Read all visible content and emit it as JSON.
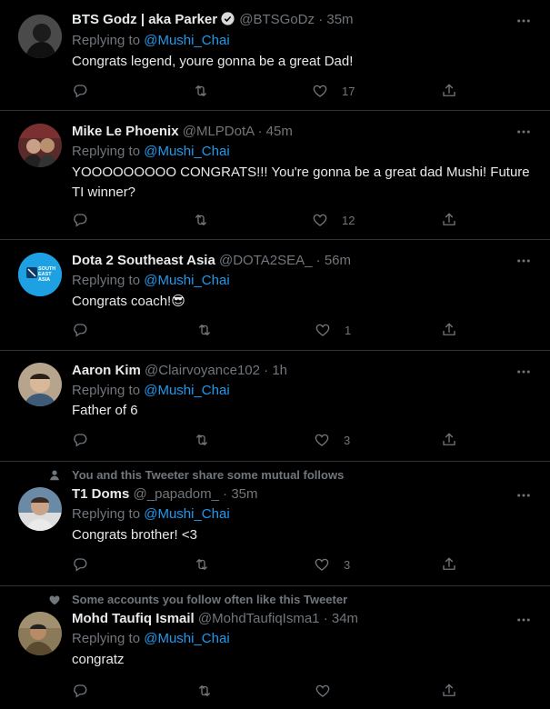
{
  "colors": {
    "background": "#000000",
    "accent": "#1d9bf0",
    "secondary_text": "#71767b",
    "divider": "#2f3336"
  },
  "replying_label": "Replying to",
  "tweets": [
    {
      "name": "BTS Godz | aka Parker",
      "verified": true,
      "handle": "@BTSGoDz",
      "sep": "·",
      "time": "35m",
      "reply_to": "@Mushi_Chai",
      "text": "Congrats legend, youre gonna be a great Dad!",
      "likes": "17"
    },
    {
      "name": "Mike Le Phoenix",
      "handle": "@MLPDotA",
      "sep": "·",
      "time": "45m",
      "reply_to": "@Mushi_Chai",
      "text": "YOOOOOOOOO CONGRATS!!! You're gonna be a great dad Mushi! Future TI winner?",
      "likes": "12"
    },
    {
      "name": "Dota 2 Southeast Asia",
      "handle": "@DOTA2SEA_",
      "sep": "·",
      "time": "56m",
      "reply_to": "@Mushi_Chai",
      "text": "Congrats coach!😎",
      "likes": "1",
      "avatar_text": "SOUTH EAST ASIA"
    },
    {
      "name": "Aaron Kim",
      "handle": "@Clairvoyance102",
      "sep": "·",
      "time": "1h",
      "reply_to": "@Mushi_Chai",
      "text": "Father of 6",
      "likes": "3"
    },
    {
      "social_context": "You and this Tweeter share some mutual follows",
      "social_icon": "person-icon",
      "name": "T1 Doms",
      "handle": "@_papadom_",
      "sep": "·",
      "time": "35m",
      "reply_to": "@Mushi_Chai",
      "text": "Congrats brother! <3",
      "likes": "3"
    },
    {
      "social_context": "Some accounts you follow often like this Tweeter",
      "social_icon": "heart-icon",
      "name": "Mohd Taufiq Ismail",
      "handle": "@MohdTaufiqIsma1",
      "sep": "·",
      "time": "34m",
      "reply_to": "@Mushi_Chai",
      "text": "congratz",
      "likes": ""
    }
  ]
}
